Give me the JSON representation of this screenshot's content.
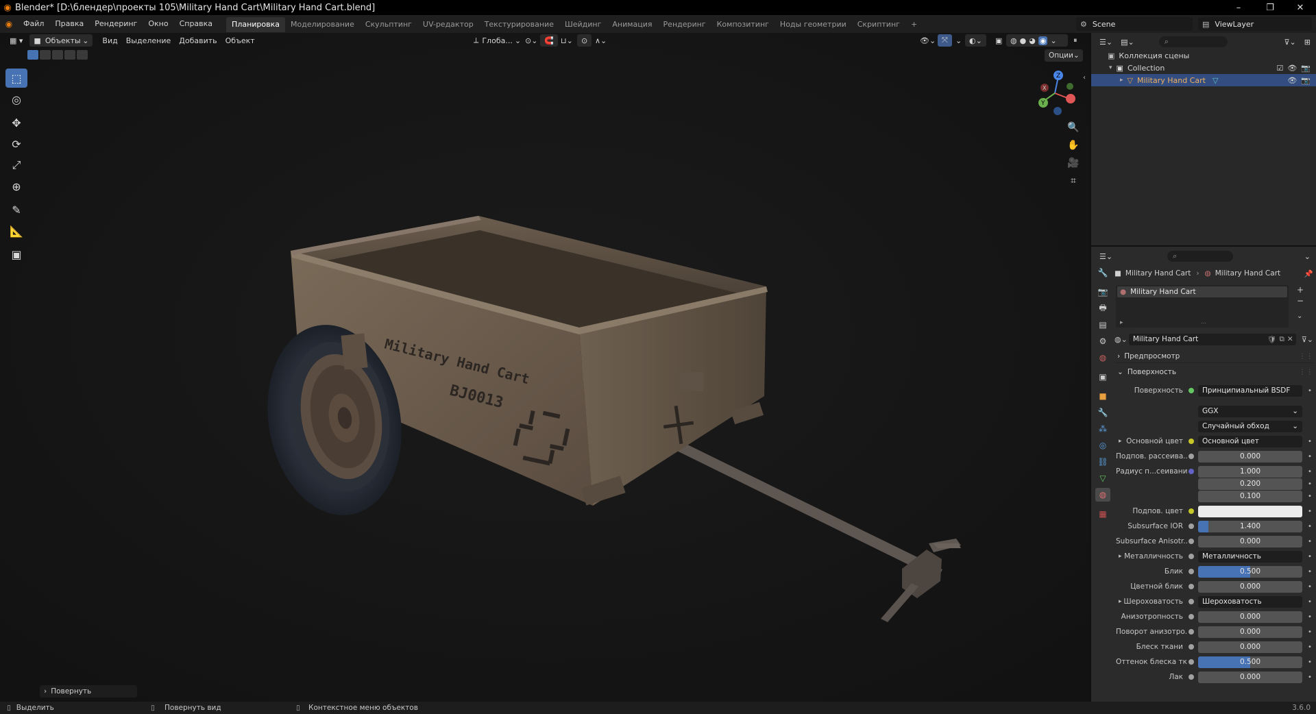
{
  "window": {
    "title": "Blender* [D:\\блендер\\проекты 105\\Military Hand Cart\\Military Hand Cart.blend]",
    "minimize": "–",
    "maximize": "❐",
    "close": "✕"
  },
  "menu": [
    "Файл",
    "Правка",
    "Рендеринг",
    "Окно",
    "Справка"
  ],
  "workspaces": {
    "tabs": [
      "Планировка",
      "Моделирование",
      "Скульптинг",
      "UV-редактор",
      "Текстурирование",
      "Шейдинг",
      "Анимация",
      "Рендеринг",
      "Композитинг",
      "Ноды геометрии",
      "Скриптинг"
    ],
    "active": 0,
    "add": "+"
  },
  "scene": {
    "name": "Scene",
    "view_layer": "ViewLayer"
  },
  "viewport_header": {
    "mode": "Объекты",
    "menus": [
      "Вид",
      "Выделение",
      "Добавить",
      "Объект"
    ],
    "orientation": "Глоба...",
    "options": "Опции"
  },
  "tools": [
    {
      "icon": "select-box-icon",
      "glyph": "⬚"
    },
    {
      "icon": "cursor-icon",
      "glyph": "◎"
    },
    {
      "icon": "move-icon",
      "glyph": "✥"
    },
    {
      "icon": "rotate-icon",
      "glyph": "⟳"
    },
    {
      "icon": "scale-icon",
      "glyph": "⤢"
    },
    {
      "icon": "transform-icon",
      "glyph": "⊕"
    },
    {
      "icon": "annotate-icon",
      "glyph": "✎"
    },
    {
      "icon": "measure-icon",
      "glyph": "📐"
    },
    {
      "icon": "add-cube-icon",
      "glyph": "▣"
    }
  ],
  "operator_panel": "Повернуть",
  "outliner": {
    "scene_collection": "Коллекция сцены",
    "collection": "Collection",
    "object": "Military Hand Cart"
  },
  "properties": {
    "breadcrumb_object": "Military Hand Cart",
    "breadcrumb_material": "Military Hand Cart",
    "slot": "Military Hand Cart",
    "material_name": "Military Hand Cart",
    "panel_preview": "Предпросмотр",
    "panel_surface": "Поверхность",
    "rows": [
      {
        "label": "Поверхность",
        "value": "Принципиальный BSDF",
        "type": "link",
        "dot": "#63c763"
      },
      {
        "label": "",
        "value": "GGX",
        "type": "dropdown"
      },
      {
        "label": "",
        "value": "Случайный обход",
        "type": "dropdown"
      },
      {
        "label": "Основной цвет",
        "value": "Основной цвет",
        "type": "link",
        "dot": "#c7c729",
        "expand": "▸"
      },
      {
        "label": "Подпов. рассеива...",
        "value": "0.000",
        "type": "number",
        "dot": "#a1a1a1"
      },
      {
        "label": "Радиус п...сеивания",
        "value": "1.000",
        "type": "number",
        "dot": "#6363c7"
      },
      {
        "label": "",
        "value": "0.200",
        "type": "number"
      },
      {
        "label": "",
        "value": "0.100",
        "type": "number"
      },
      {
        "label": "Подпов. цвет",
        "value": "",
        "type": "color",
        "dot": "#c7c729",
        "color": "#ececec"
      },
      {
        "label": "Subsurface IOR",
        "value": "1.400",
        "type": "number",
        "dot": "#a1a1a1",
        "fill": 0.1
      },
      {
        "label": "Subsurface Anisotr...",
        "value": "0.000",
        "type": "number",
        "dot": "#a1a1a1"
      },
      {
        "label": "Металличность",
        "value": "Металличность",
        "type": "link",
        "dot": "#a1a1a1",
        "expand": "▸"
      },
      {
        "label": "Блик",
        "value": "0.500",
        "type": "number",
        "dot": "#a1a1a1",
        "fill": 0.5
      },
      {
        "label": "Цветной блик",
        "value": "0.000",
        "type": "number",
        "dot": "#a1a1a1"
      },
      {
        "label": "Шероховатость",
        "value": "Шероховатость",
        "type": "link",
        "dot": "#a1a1a1",
        "expand": "▸"
      },
      {
        "label": "Анизотропность",
        "value": "0.000",
        "type": "number",
        "dot": "#a1a1a1"
      },
      {
        "label": "Поворот анизотро...",
        "value": "0.000",
        "type": "number",
        "dot": "#a1a1a1"
      },
      {
        "label": "Блеск ткани",
        "value": "0.000",
        "type": "number",
        "dot": "#a1a1a1"
      },
      {
        "label": "Оттенок блеска тк...",
        "value": "0.500",
        "type": "number",
        "dot": "#a1a1a1",
        "fill": 0.5
      },
      {
        "label": "Лак",
        "value": "0.000",
        "type": "number",
        "dot": "#a1a1a1"
      }
    ]
  },
  "model_text": {
    "line1": "Military Hand Cart",
    "line2": "BJ0013"
  },
  "statusbar": {
    "select": "Выделить",
    "rotate_view": "Повернуть вид",
    "context_menu": "Контекстное меню объектов",
    "version": "3.6.0"
  },
  "colors": {
    "accent": "#4772b3",
    "selected_row": "#334d80",
    "orange": "#e87d0d"
  }
}
